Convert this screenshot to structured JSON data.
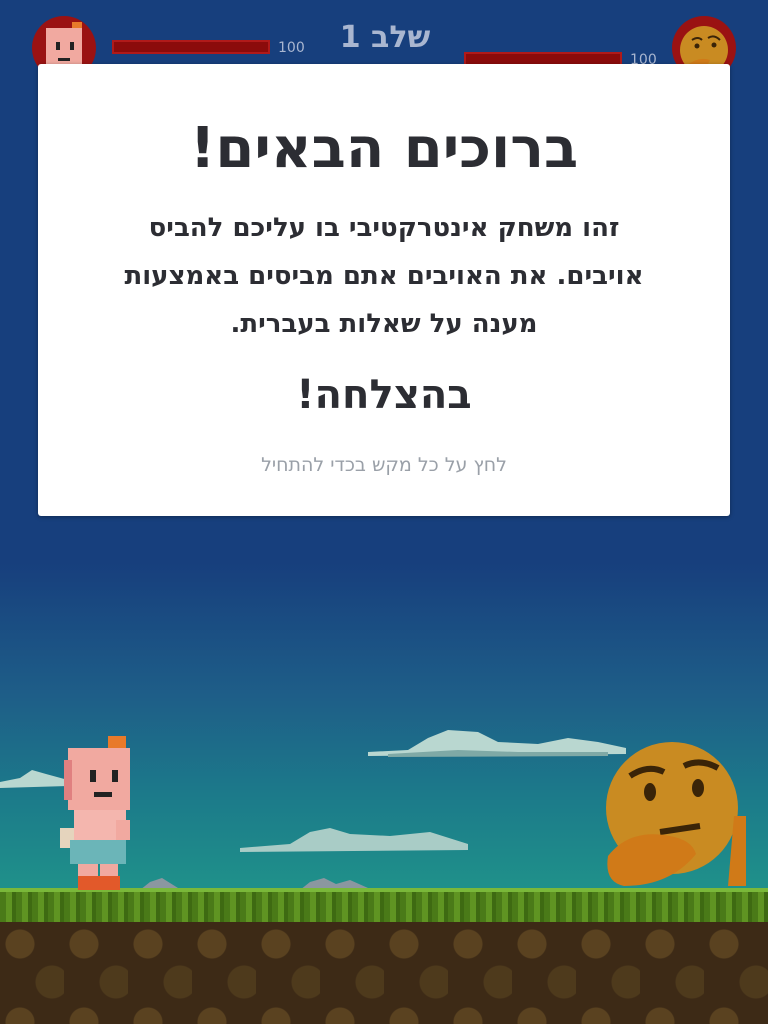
{
  "hud": {
    "level_label": "שלב 1",
    "player": {
      "hp_text": "100",
      "hp_fraction": 1.0,
      "avatar_icon": "pixel-girl-avatar-icon"
    },
    "enemy": {
      "hp_text": "100",
      "hp_fraction": 1.0,
      "avatar_icon": "thinking-face-avatar-icon"
    }
  },
  "modal": {
    "title": "ברוכים הבאים!",
    "body": "זהו משחק אינטרקטיבי בו עליכם להביס אויבים. את האויבים אתם מביסים באמצעות מענה על שאלות בעברית.",
    "subtitle": "בהצלחה!",
    "hint": "לחץ על כל מקש בכדי להתחיל"
  },
  "scene": {
    "hero_icon": "pixel-girl-character-icon",
    "enemy_icon": "thinking-face-emoji-icon",
    "colors": {
      "sky": "#173f7d",
      "hp_bar": "#8b0b0b",
      "avatar_bg": "#9a1212",
      "grass": "#5f9422",
      "dirt": "#3d2a16"
    }
  }
}
